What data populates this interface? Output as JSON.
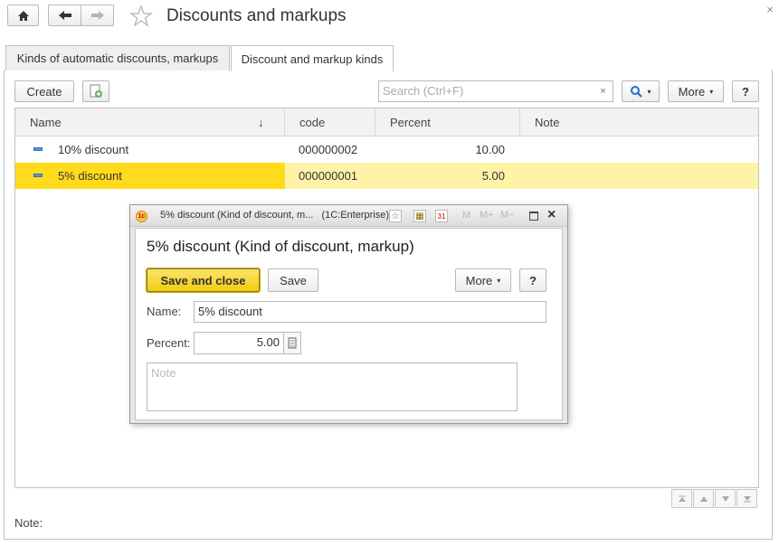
{
  "window": {
    "title": "Discounts and markups"
  },
  "tabs": [
    {
      "label": "Kinds of automatic discounts, markups"
    },
    {
      "label": "Discount and markup kinds"
    }
  ],
  "toolbar": {
    "create_label": "Create",
    "search_placeholder": "Search (Ctrl+F)",
    "clear_label": "×",
    "more_label": "More",
    "help_label": "?"
  },
  "table": {
    "columns": [
      "Name",
      "code",
      "Percent",
      "Note"
    ],
    "rows": [
      {
        "name": "10% discount",
        "code": "000000002",
        "percent": "10.00",
        "note": ""
      },
      {
        "name": "5% discount",
        "code": "000000001",
        "percent": "5.00",
        "note": ""
      }
    ],
    "selected_row": 1,
    "sort_indicator": "↓"
  },
  "footer": {
    "note_label": "Note:"
  },
  "dialog": {
    "window_title": "5% discount (Kind of discount, m...",
    "app_label": "(1C:Enterprise)",
    "m_label": "M",
    "mplus_label": "M+",
    "mminus_label": "M−",
    "heading": "5% discount (Kind of discount, markup)",
    "save_close_label": "Save and close",
    "save_label": "Save",
    "more_label": "More",
    "help_label": "?",
    "name_label": "Name:",
    "name_value": "5% discount",
    "percent_label": "Percent:",
    "percent_value": "5.00",
    "note_placeholder": "Note"
  },
  "colors": {
    "selected_row": "#fff3a8",
    "selected_cell": "#ffdb1c",
    "primary_button": "#f9d71c"
  }
}
